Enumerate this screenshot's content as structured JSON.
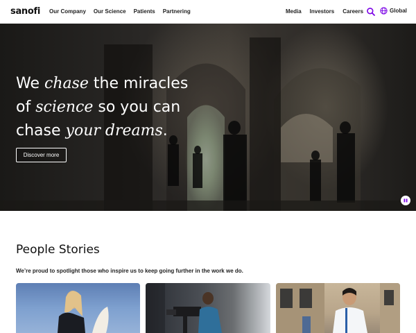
{
  "header": {
    "logo": "sanofi",
    "nav_left": [
      "Our Company",
      "Our Science",
      "Patients",
      "Partnering"
    ],
    "nav_right": [
      "Media",
      "Investors",
      "Careers"
    ],
    "global_label": "Global",
    "accent_color": "#7a00e6"
  },
  "hero": {
    "line1_a": "We ",
    "line1_b": "chase",
    "line1_c": " the miracles",
    "line2_a": "of ",
    "line2_b": "science",
    "line2_c": " so you can",
    "line3_a": "chase ",
    "line3_b": "your dreams",
    "line3_c": ".",
    "cta_label": "Discover more",
    "pause_icon": "pause-icon"
  },
  "stories": {
    "title": "People Stories",
    "subtitle": "We’re proud to spotlight those who inspire us to keep going further in the work we do."
  }
}
